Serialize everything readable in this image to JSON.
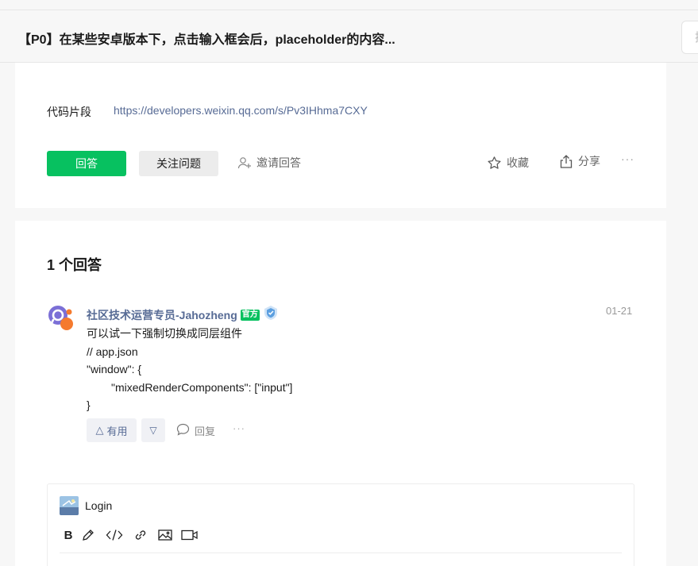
{
  "header": {
    "title": "【P0】在某些安卓版本下，点击输入框会后，placeholder的内容...",
    "search_hint": "搜"
  },
  "question": {
    "snippet_label": "代码片段",
    "snippet_url": "https://developers.weixin.qq.com/s/Pv3IHhma7CXY",
    "actions": {
      "answer": "回答",
      "follow": "关注问题",
      "invite": "邀请回答",
      "collect": "收藏",
      "share": "分享",
      "more": "···"
    }
  },
  "answers": {
    "count_label": "1 个回答",
    "items": [
      {
        "author": "社区技术运营专员-Jahozheng",
        "badge": "官方",
        "date": "01-21",
        "lines": [
          "可以试一下强制切换成同层组件",
          "// app.json",
          "\"window\": {",
          "\"mixedRenderComponents\": [\"input\"]",
          "}"
        ],
        "useful_label": "有用",
        "reply_label": "回复",
        "more": "···"
      }
    ]
  },
  "editor": {
    "username": "Login"
  },
  "colors": {
    "accent": "#07c160",
    "link": "#576b95",
    "background": "#f7f7f7"
  }
}
